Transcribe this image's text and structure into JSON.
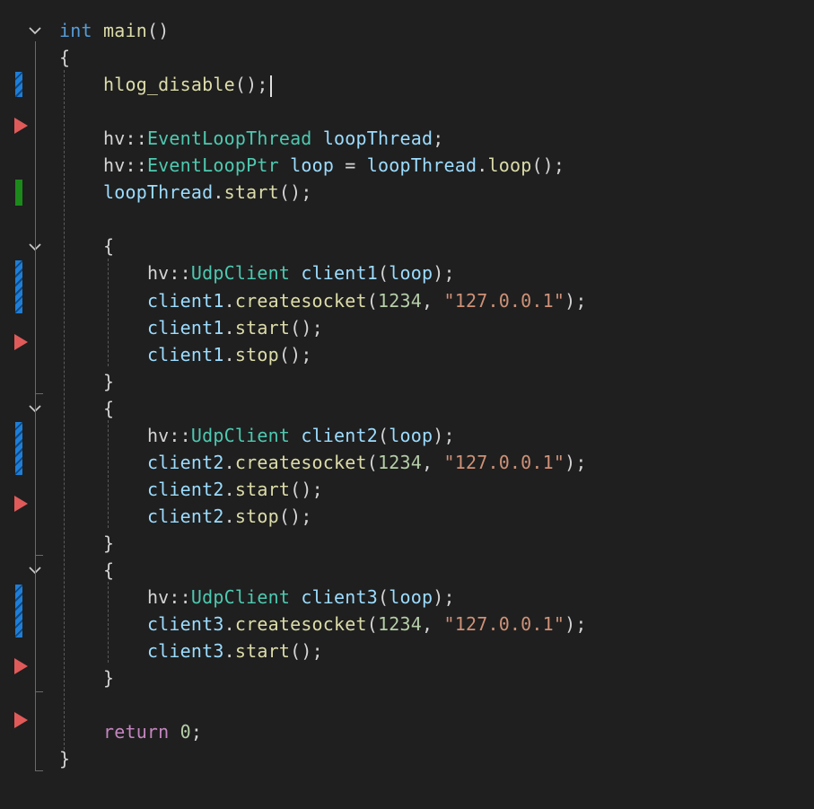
{
  "code_lines": [
    {
      "tokens": [
        {
          "t": "int",
          "c": "kw"
        },
        {
          "t": " "
        },
        {
          "t": "main",
          "c": "fn"
        },
        {
          "t": "()",
          "c": "punc"
        }
      ]
    },
    {
      "tokens": [
        {
          "t": "{",
          "c": "punc"
        }
      ]
    },
    {
      "tokens": [
        {
          "t": "    "
        },
        {
          "t": "hlog_disable",
          "c": "fn"
        },
        {
          "t": "();",
          "c": "punc"
        }
      ],
      "caret": true
    },
    {
      "tokens": []
    },
    {
      "tokens": [
        {
          "t": "    "
        },
        {
          "t": "hv",
          "c": "ns"
        },
        {
          "t": "::",
          "c": "punc"
        },
        {
          "t": "EventLoopThread",
          "c": "ty"
        },
        {
          "t": " "
        },
        {
          "t": "loopThread",
          "c": "var"
        },
        {
          "t": ";",
          "c": "punc"
        }
      ]
    },
    {
      "tokens": [
        {
          "t": "    "
        },
        {
          "t": "hv",
          "c": "ns"
        },
        {
          "t": "::",
          "c": "punc"
        },
        {
          "t": "EventLoopPtr",
          "c": "ty"
        },
        {
          "t": " "
        },
        {
          "t": "loop",
          "c": "var"
        },
        {
          "t": " = ",
          "c": "punc"
        },
        {
          "t": "loopThread",
          "c": "var"
        },
        {
          "t": ".",
          "c": "punc"
        },
        {
          "t": "loop",
          "c": "fn"
        },
        {
          "t": "();",
          "c": "punc"
        }
      ]
    },
    {
      "tokens": [
        {
          "t": "    "
        },
        {
          "t": "loopThread",
          "c": "var"
        },
        {
          "t": ".",
          "c": "punc"
        },
        {
          "t": "start",
          "c": "fn"
        },
        {
          "t": "();",
          "c": "punc"
        }
      ]
    },
    {
      "tokens": []
    },
    {
      "tokens": [
        {
          "t": "    "
        },
        {
          "t": "{",
          "c": "punc"
        }
      ]
    },
    {
      "tokens": [
        {
          "t": "        "
        },
        {
          "t": "hv",
          "c": "ns"
        },
        {
          "t": "::",
          "c": "punc"
        },
        {
          "t": "UdpClient",
          "c": "ty"
        },
        {
          "t": " "
        },
        {
          "t": "client1",
          "c": "var"
        },
        {
          "t": "(",
          "c": "punc"
        },
        {
          "t": "loop",
          "c": "var"
        },
        {
          "t": ");",
          "c": "punc"
        }
      ]
    },
    {
      "tokens": [
        {
          "t": "        "
        },
        {
          "t": "client1",
          "c": "var"
        },
        {
          "t": ".",
          "c": "punc"
        },
        {
          "t": "createsocket",
          "c": "fn"
        },
        {
          "t": "(",
          "c": "punc"
        },
        {
          "t": "1234",
          "c": "num"
        },
        {
          "t": ", ",
          "c": "punc"
        },
        {
          "t": "\"127.0.0.1\"",
          "c": "str"
        },
        {
          "t": ");",
          "c": "punc"
        }
      ]
    },
    {
      "tokens": [
        {
          "t": "        "
        },
        {
          "t": "client1",
          "c": "var"
        },
        {
          "t": ".",
          "c": "punc"
        },
        {
          "t": "start",
          "c": "fn"
        },
        {
          "t": "();",
          "c": "punc"
        }
      ]
    },
    {
      "tokens": [
        {
          "t": "        "
        },
        {
          "t": "client1",
          "c": "var"
        },
        {
          "t": ".",
          "c": "punc"
        },
        {
          "t": "stop",
          "c": "fn"
        },
        {
          "t": "();",
          "c": "punc"
        }
      ]
    },
    {
      "tokens": [
        {
          "t": "    "
        },
        {
          "t": "}",
          "c": "punc"
        }
      ]
    },
    {
      "tokens": [
        {
          "t": "    "
        },
        {
          "t": "{",
          "c": "punc"
        }
      ]
    },
    {
      "tokens": [
        {
          "t": "        "
        },
        {
          "t": "hv",
          "c": "ns"
        },
        {
          "t": "::",
          "c": "punc"
        },
        {
          "t": "UdpClient",
          "c": "ty"
        },
        {
          "t": " "
        },
        {
          "t": "client2",
          "c": "var"
        },
        {
          "t": "(",
          "c": "punc"
        },
        {
          "t": "loop",
          "c": "var"
        },
        {
          "t": ");",
          "c": "punc"
        }
      ]
    },
    {
      "tokens": [
        {
          "t": "        "
        },
        {
          "t": "client2",
          "c": "var"
        },
        {
          "t": ".",
          "c": "punc"
        },
        {
          "t": "createsocket",
          "c": "fn"
        },
        {
          "t": "(",
          "c": "punc"
        },
        {
          "t": "1234",
          "c": "num"
        },
        {
          "t": ", ",
          "c": "punc"
        },
        {
          "t": "\"127.0.0.1\"",
          "c": "str"
        },
        {
          "t": ");",
          "c": "punc"
        }
      ]
    },
    {
      "tokens": [
        {
          "t": "        "
        },
        {
          "t": "client2",
          "c": "var"
        },
        {
          "t": ".",
          "c": "punc"
        },
        {
          "t": "start",
          "c": "fn"
        },
        {
          "t": "();",
          "c": "punc"
        }
      ]
    },
    {
      "tokens": [
        {
          "t": "        "
        },
        {
          "t": "client2",
          "c": "var"
        },
        {
          "t": ".",
          "c": "punc"
        },
        {
          "t": "stop",
          "c": "fn"
        },
        {
          "t": "();",
          "c": "punc"
        }
      ]
    },
    {
      "tokens": [
        {
          "t": "    "
        },
        {
          "t": "}",
          "c": "punc"
        }
      ]
    },
    {
      "tokens": [
        {
          "t": "    "
        },
        {
          "t": "{",
          "c": "punc"
        }
      ]
    },
    {
      "tokens": [
        {
          "t": "        "
        },
        {
          "t": "hv",
          "c": "ns"
        },
        {
          "t": "::",
          "c": "punc"
        },
        {
          "t": "UdpClient",
          "c": "ty"
        },
        {
          "t": " "
        },
        {
          "t": "client3",
          "c": "var"
        },
        {
          "t": "(",
          "c": "punc"
        },
        {
          "t": "loop",
          "c": "var"
        },
        {
          "t": ");",
          "c": "punc"
        }
      ]
    },
    {
      "tokens": [
        {
          "t": "        "
        },
        {
          "t": "client3",
          "c": "var"
        },
        {
          "t": ".",
          "c": "punc"
        },
        {
          "t": "createsocket",
          "c": "fn"
        },
        {
          "t": "(",
          "c": "punc"
        },
        {
          "t": "1234",
          "c": "num"
        },
        {
          "t": ", ",
          "c": "punc"
        },
        {
          "t": "\"127.0.0.1\"",
          "c": "str"
        },
        {
          "t": ");",
          "c": "punc"
        }
      ]
    },
    {
      "tokens": [
        {
          "t": "        "
        },
        {
          "t": "client3",
          "c": "var"
        },
        {
          "t": ".",
          "c": "punc"
        },
        {
          "t": "start",
          "c": "fn"
        },
        {
          "t": "();",
          "c": "punc"
        }
      ]
    },
    {
      "tokens": [
        {
          "t": "    "
        },
        {
          "t": "}",
          "c": "punc"
        }
      ]
    },
    {
      "tokens": []
    },
    {
      "tokens": [
        {
          "t": "    "
        },
        {
          "t": "return",
          "c": "kwc"
        },
        {
          "t": " "
        },
        {
          "t": "0",
          "c": "num"
        },
        {
          "t": ";",
          "c": "punc"
        }
      ]
    },
    {
      "tokens": [
        {
          "t": "}",
          "c": "punc"
        }
      ]
    }
  ],
  "gutter": {
    "fold_icons": [
      "chevron-down-icon",
      "chevron-down-icon",
      "chevron-down-icon",
      "chevron-down-icon"
    ],
    "change_markers": [
      "modified",
      "breakpoint",
      "added",
      "modified",
      "breakpoint",
      "modified",
      "breakpoint",
      "modified",
      "breakpoint",
      "breakpoint"
    ]
  },
  "colors": {
    "background": "#1f1f1f",
    "keyword": "#569cd6",
    "control_keyword": "#c586c0",
    "function": "#dcdcaa",
    "type": "#4ec9b0",
    "variable": "#9cdcfe",
    "number": "#b5cea8",
    "string": "#ce9178",
    "breakpoint": "#e05a5a",
    "modified_marker": "#1f7ed6",
    "added_marker": "#1b8a1b"
  }
}
